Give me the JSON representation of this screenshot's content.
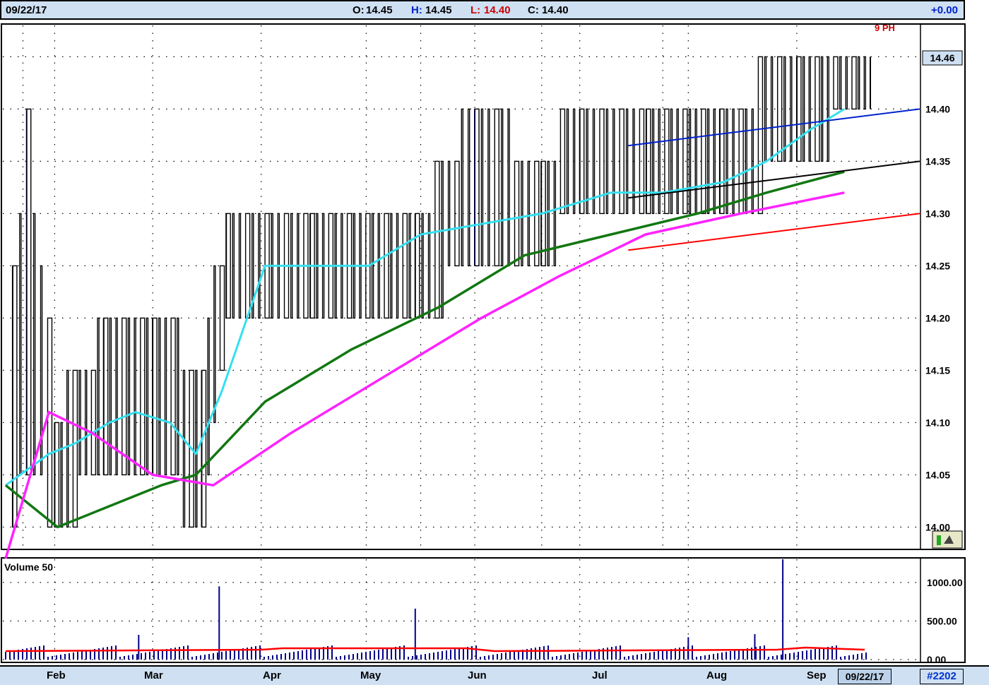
{
  "header": {
    "date": "09/22/17",
    "open_label": "O:",
    "open": "14.45",
    "high_label": "H:",
    "high": "14.45",
    "low_label": "L:",
    "low": "14.40",
    "close_label": "C:",
    "close": "14.40",
    "change": "+0.00"
  },
  "footer": {
    "months": [
      "Feb",
      "Mar",
      "Apr",
      "May",
      "Jun",
      "Jul",
      "Aug",
      "Sep"
    ],
    "date_box": "09/22/17",
    "id": "#2202"
  },
  "price_label": "14.46",
  "volume_label": "Volume 50",
  "corner_label": "9 PH",
  "colors": {
    "bar": "#000000",
    "bar_highlight": "#0000cc",
    "ma_fast": "#33e0f0",
    "ma_mid": "#117711",
    "ma_slow": "#ff22ff",
    "trend_top": "#0022cc",
    "trend_mid": "#000000",
    "trend_low": "#ff0000",
    "volume_bar": "#000088",
    "volume_ma": "#ff0000",
    "low_text": "#cc0000",
    "change_text": "#0022cc"
  },
  "chart_data": [
    {
      "type": "ohlc",
      "x_axis": "date 2017",
      "yticks": [
        "14.00",
        "14.05",
        "14.10",
        "14.15",
        "14.20",
        "14.25",
        "14.30",
        "14.35",
        "14.40",
        "14.45"
      ],
      "ylim": [
        13.98,
        14.48
      ],
      "grid": true,
      "series": [
        {
          "kind": "price",
          "sample": [
            {
              "date": "2017-01-20",
              "high": 14.25,
              "low": 14.0
            },
            {
              "date": "2017-01-24",
              "high": 14.4,
              "low": 14.05
            },
            {
              "date": "2017-02-01",
              "high": 14.1,
              "low": 14.0
            },
            {
              "date": "2017-02-15",
              "high": 14.2,
              "low": 14.05
            },
            {
              "date": "2017-03-01",
              "high": 14.2,
              "low": 14.05
            },
            {
              "date": "2017-03-15",
              "high": 14.15,
              "low": 14.0
            },
            {
              "date": "2017-03-22",
              "high": 14.3,
              "low": 14.2
            },
            {
              "date": "2017-04-15",
              "high": 14.3,
              "low": 14.2
            },
            {
              "date": "2017-05-15",
              "high": 14.3,
              "low": 14.2
            },
            {
              "date": "2017-06-01",
              "high": 14.4,
              "low": 14.25
            },
            {
              "date": "2017-06-20",
              "high": 14.35,
              "low": 14.25
            },
            {
              "date": "2017-07-01",
              "high": 14.4,
              "low": 14.3
            },
            {
              "date": "2017-07-20",
              "high": 14.4,
              "low": 14.3
            },
            {
              "date": "2017-08-10",
              "high": 14.4,
              "low": 14.3
            },
            {
              "date": "2017-09-01",
              "high": 14.45,
              "low": 14.35
            },
            {
              "date": "2017-09-22",
              "high": 14.45,
              "low": 14.4
            }
          ]
        },
        {
          "kind": "ma_fast",
          "points": [
            [
              0,
              14.04
            ],
            [
              0.05,
              14.07
            ],
            [
              0.08,
              14.08
            ],
            [
              0.12,
              14.1
            ],
            [
              0.15,
              14.11
            ],
            [
              0.19,
              14.1
            ],
            [
              0.22,
              14.07
            ],
            [
              0.25,
              14.13
            ],
            [
              0.3,
              14.25
            ],
            [
              0.36,
              14.25
            ],
            [
              0.42,
              14.25
            ],
            [
              0.48,
              14.28
            ],
            [
              0.55,
              14.29
            ],
            [
              0.62,
              14.3
            ],
            [
              0.7,
              14.32
            ],
            [
              0.76,
              14.32
            ],
            [
              0.83,
              14.33
            ],
            [
              0.88,
              14.35
            ],
            [
              0.93,
              14.38
            ],
            [
              0.97,
              14.4
            ]
          ]
        },
        {
          "kind": "ma_mid",
          "points": [
            [
              0,
              14.04
            ],
            [
              0.06,
              14.0
            ],
            [
              0.12,
              14.02
            ],
            [
              0.18,
              14.04
            ],
            [
              0.22,
              14.05
            ],
            [
              0.3,
              14.12
            ],
            [
              0.4,
              14.17
            ],
            [
              0.5,
              14.21
            ],
            [
              0.6,
              14.26
            ],
            [
              0.7,
              14.28
            ],
            [
              0.8,
              14.3
            ],
            [
              0.88,
              14.32
            ],
            [
              0.97,
              14.34
            ]
          ]
        },
        {
          "kind": "ma_slow",
          "points": [
            [
              0,
              13.97
            ],
            [
              0.05,
              14.11
            ],
            [
              0.1,
              14.09
            ],
            [
              0.17,
              14.05
            ],
            [
              0.24,
              14.04
            ],
            [
              0.33,
              14.09
            ],
            [
              0.45,
              14.15
            ],
            [
              0.55,
              14.2
            ],
            [
              0.64,
              14.24
            ],
            [
              0.74,
              14.28
            ],
            [
              0.85,
              14.3
            ],
            [
              0.97,
              14.32
            ]
          ]
        },
        {
          "kind": "trend_top",
          "points": [
            [
              0.72,
              14.365
            ],
            [
              1.0,
              14.4
            ]
          ]
        },
        {
          "kind": "trend_mid",
          "points": [
            [
              0.72,
              14.315
            ],
            [
              1.0,
              14.35
            ]
          ]
        },
        {
          "kind": "trend_low",
          "points": [
            [
              0.72,
              14.265
            ],
            [
              1.0,
              14.3
            ]
          ]
        }
      ]
    },
    {
      "type": "bar",
      "title": "Volume 50",
      "yticks": [
        "0.00",
        "500.00",
        "1000.00"
      ],
      "ylim": [
        0,
        1300
      ],
      "grid": true,
      "spikes": [
        {
          "date": "2017-02-25",
          "value": 320
        },
        {
          "date": "2017-03-20",
          "value": 950
        },
        {
          "date": "2017-05-15",
          "value": 660
        },
        {
          "date": "2017-08-01",
          "value": 290
        },
        {
          "date": "2017-08-28",
          "value": 1300
        },
        {
          "date": "2017-08-20",
          "value": 330
        }
      ]
    }
  ]
}
